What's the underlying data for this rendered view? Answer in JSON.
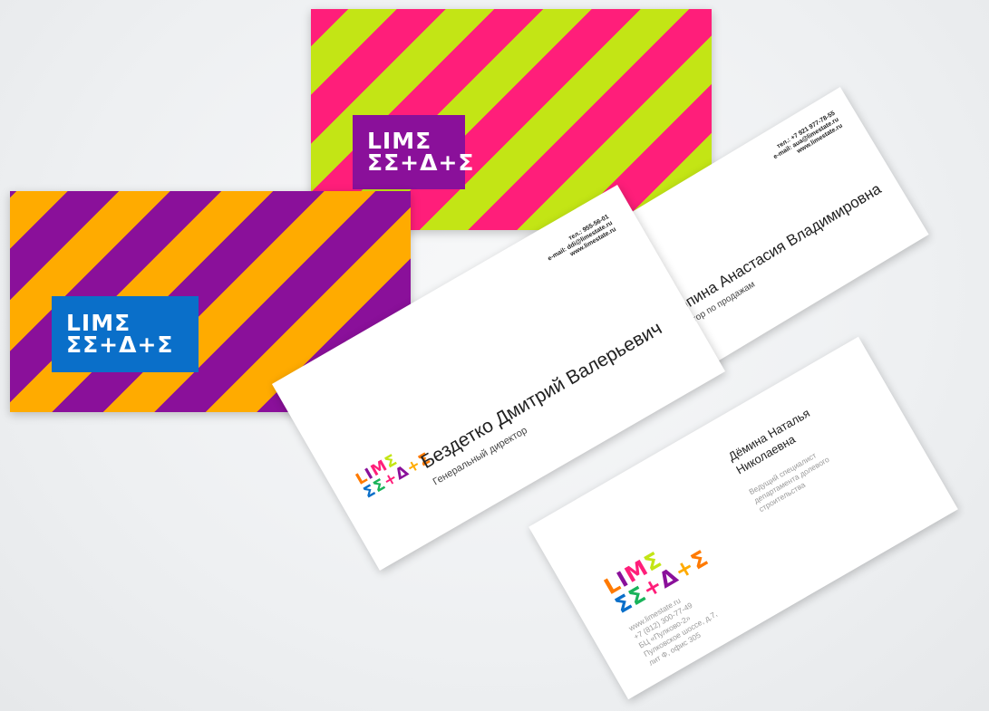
{
  "logo": {
    "line1": "LIMΣ",
    "line2": "ΣΣ+Δ+Σ"
  },
  "colors": {
    "pink": "#ff1e7a",
    "lime": "#c3e515",
    "purple": "#8a109a",
    "orange": "#ffab00",
    "blue": "#0a6fc9"
  },
  "card_dmitry": {
    "name": "Бездетко Дмитрий Валерьевич",
    "role": "Генеральный директор",
    "tel": "тел.: 955-56-01",
    "email": "e-mail: ddi@limestate.ru",
    "web": "www.limestate.ru"
  },
  "card_anastasia": {
    "name": "Урюпина Анастасия Владимировна",
    "role": "Директор по продажам",
    "tel": "тел.: +7 921 977-78-55",
    "email": "e-mail: aua@limestate.ru",
    "web": "www.limestate.ru"
  },
  "card_natalia": {
    "name_line1": "Дёмина Наталья",
    "name_line2": "Николаевна",
    "role_line1": "Ведущий специалист",
    "role_line2": "департамента долевого",
    "role_line3": "строительства",
    "web": "www.limestate.ru",
    "phone": "+7 (812) 300-77-49",
    "addr1": "БЦ «Пулково-2»",
    "addr2": "Пулковское шоссе, д.7,",
    "addr3": "лит Ф, офис 305"
  }
}
